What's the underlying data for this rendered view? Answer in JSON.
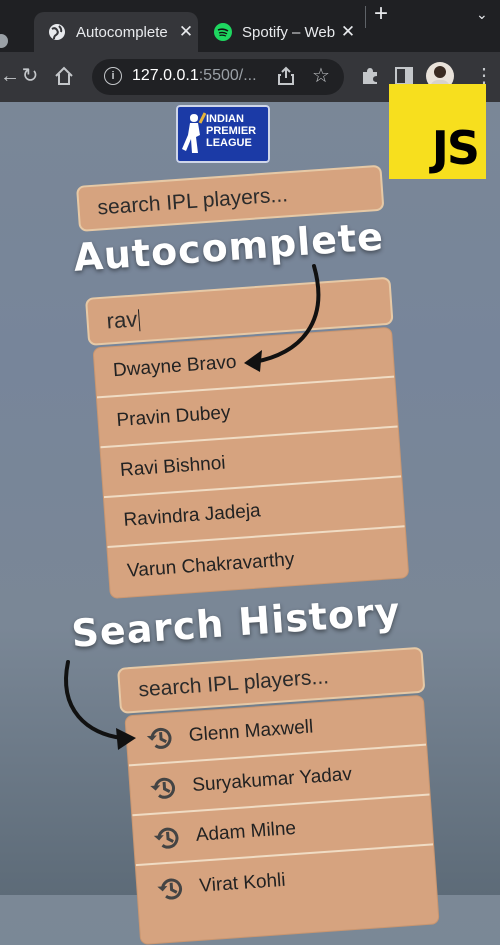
{
  "browser": {
    "tabs": [
      {
        "title": "Autocomplete",
        "active": true
      },
      {
        "title": "Spotify – Web",
        "active": false
      }
    ],
    "new_tab": "+",
    "url_host": "127.0.0.1",
    "url_rest": ":5500/..."
  },
  "logos": {
    "ipl": [
      "INDIAN",
      "PREMIER",
      "LEAGUE"
    ],
    "js": "JS"
  },
  "captions": {
    "autocomplete": "Autocomplete",
    "search_history": "Search History"
  },
  "search_top": {
    "placeholder": "search IPL players..."
  },
  "autocomplete_demo": {
    "query": "rav",
    "suggestions": [
      "Dwayne Bravo",
      "Pravin Dubey",
      "Ravi Bishnoi",
      "Ravindra Jadeja",
      "Varun Chakravarthy"
    ]
  },
  "history_demo": {
    "placeholder": "search IPL players...",
    "items": [
      "Glenn Maxwell",
      "Suryakumar Yadav",
      "Adam Milne",
      "Virat Kohli"
    ]
  },
  "colors": {
    "box": "#d6a37f",
    "js_yellow": "#f7df1e",
    "ipl_blue": "#1b3aa6"
  }
}
